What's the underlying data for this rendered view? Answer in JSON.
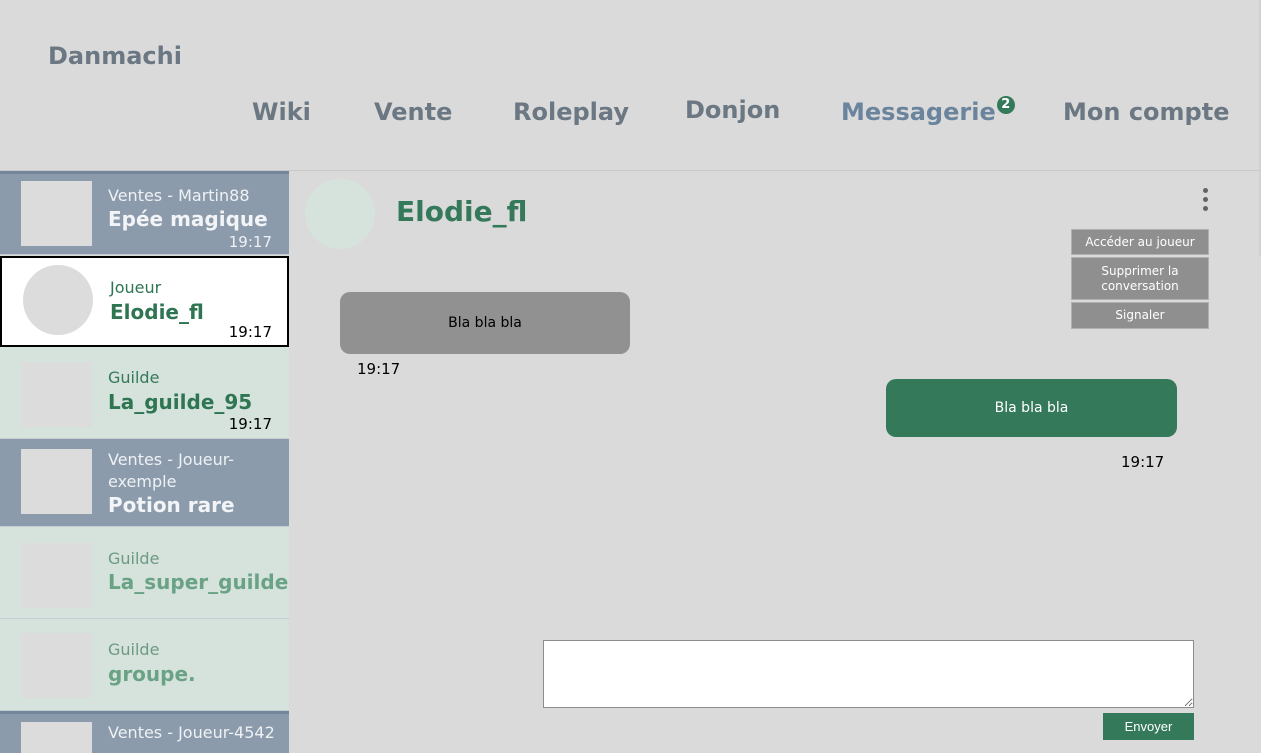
{
  "app": {
    "brand": "Danmachi"
  },
  "nav": {
    "items": [
      {
        "label": "Wiki"
      },
      {
        "label": "Vente"
      },
      {
        "label": "Roleplay"
      },
      {
        "label": "Donjon"
      },
      {
        "label": "Messagerie",
        "badge": "2",
        "active": true
      },
      {
        "label": "Mon compte"
      }
    ]
  },
  "conversations": [
    {
      "type": "Ventes - Martin88",
      "name": "Epée magique",
      "time": "19:17",
      "kind": "sale"
    },
    {
      "type": "Joueur",
      "name": "Elodie_fl",
      "time": "19:17",
      "kind": "player",
      "selected": true
    },
    {
      "type": "Guilde",
      "name": "La_guilde_95",
      "time": "19:17",
      "kind": "guild",
      "unread": true
    },
    {
      "type": "Ventes - Joueur-exemple",
      "name": "Potion rare",
      "time": "",
      "kind": "sale"
    },
    {
      "type": "Guilde",
      "name": "La_super_guilde",
      "time": "",
      "kind": "guild"
    },
    {
      "type": "Guilde",
      "name": "groupe.",
      "time": "",
      "kind": "guild"
    },
    {
      "type": "Ventes - Joueur-4542",
      "name": "",
      "time": "",
      "kind": "sale"
    }
  ],
  "chat": {
    "contact_name": "Elodie_fl",
    "menu": [
      "Accéder au joueur",
      "Supprimer la conversation",
      "Signaler"
    ],
    "messages": [
      {
        "direction": "in",
        "text": "Bla bla bla",
        "time": "19:17"
      },
      {
        "direction": "out",
        "text": "Bla bla bla",
        "time": "19:17"
      }
    ],
    "input_value": "",
    "send_label": "Envoyer"
  },
  "colors": {
    "accent": "#35795b",
    "sale_item": "#8c9bab",
    "guild_item": "#d6e2dc",
    "background": "#dadada",
    "nav_text": "#6b7782",
    "nav_active": "#6b849d"
  }
}
